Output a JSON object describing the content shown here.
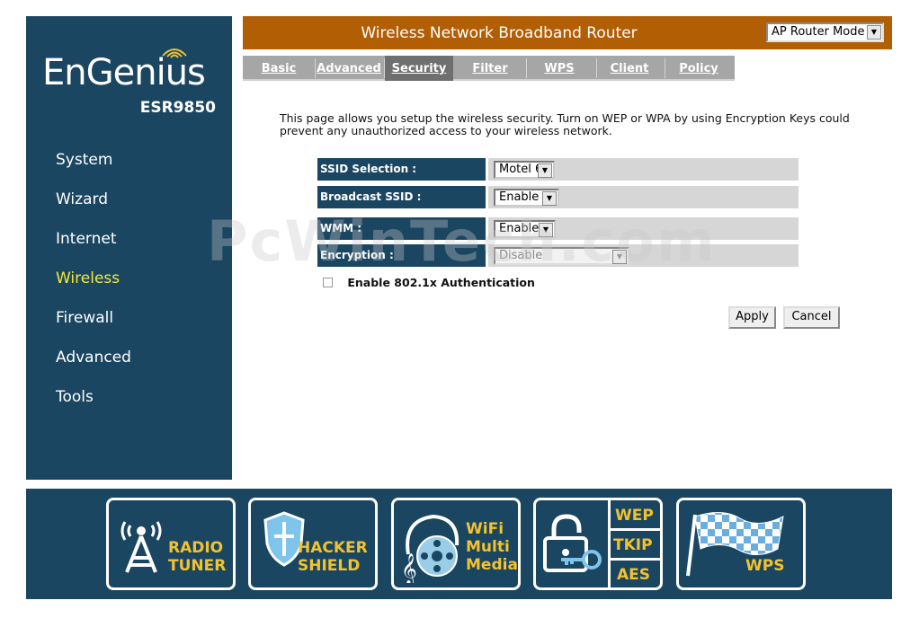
{
  "brand": {
    "logo": "EnGenius",
    "model": "ESR9850"
  },
  "sidebar": {
    "items": [
      {
        "label": "System"
      },
      {
        "label": "Wizard"
      },
      {
        "label": "Internet"
      },
      {
        "label": "Wireless",
        "active": true
      },
      {
        "label": "Firewall"
      },
      {
        "label": "Advanced"
      },
      {
        "label": "Tools"
      }
    ]
  },
  "header": {
    "title": "Wireless Network Broadband Router",
    "mode": "AP Router Mode"
  },
  "tabs": [
    {
      "label": "Basic"
    },
    {
      "label": "Advanced"
    },
    {
      "label": "Security",
      "active": true
    },
    {
      "label": "Filter"
    },
    {
      "label": "WPS"
    },
    {
      "label": "Client List"
    },
    {
      "label": "Policy"
    }
  ],
  "description": "This page allows you setup the wireless security. Turn on WEP or WPA by using Encryption Keys could prevent any unauthorized access to your wireless network.",
  "form": {
    "ssid_selection": {
      "label": "SSID Selection :",
      "value": "Motel 6"
    },
    "broadcast_ssid": {
      "label": "Broadcast SSID :",
      "value": "Enable"
    },
    "wmm": {
      "label": "WMM :",
      "value": "Enable"
    },
    "encryption": {
      "label": "Encryption :",
      "value": "Disable"
    },
    "auth_8021x": {
      "label": "Enable 802.1x Authentication",
      "checked": false
    }
  },
  "buttons": {
    "apply": "Apply",
    "cancel": "Cancel"
  },
  "watermark": "PcWinTech.com",
  "footer": {
    "badges": [
      {
        "icon": "radio-tower-icon",
        "line1": "RADIO",
        "line2": "TUNER"
      },
      {
        "icon": "shield-icon",
        "line1": "HACKER",
        "line2": "SHIELD"
      },
      {
        "icon": "media-icon",
        "line1": "WiFi",
        "line2": "Multi",
        "line3": "Media"
      },
      {
        "icon": "lock-key-icon",
        "line1": "WEP",
        "line2": "TKIP",
        "line3": "AES"
      },
      {
        "icon": "checkered-flag-icon",
        "line1": "WPS"
      }
    ]
  },
  "colors": {
    "navy": "#1b4661",
    "header_orange": "#b15e05",
    "active_nav": "#f4e93a",
    "badge_gold": "#f2c230"
  }
}
